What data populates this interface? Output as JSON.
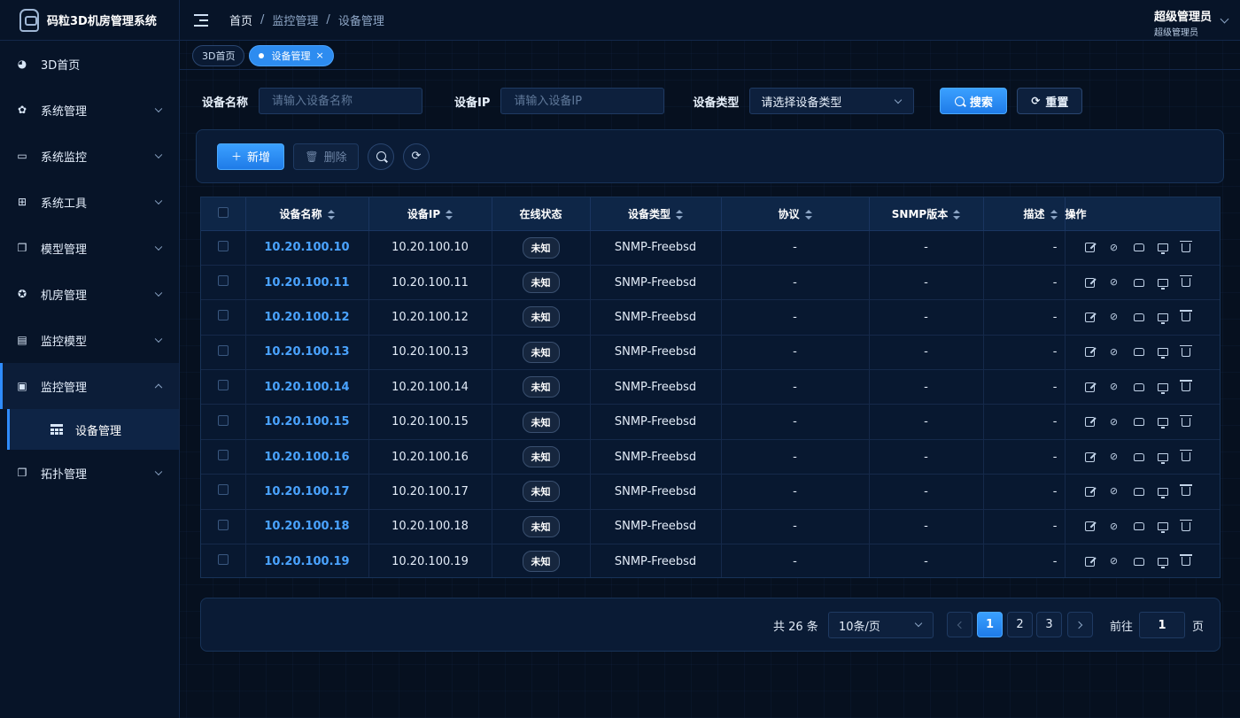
{
  "app": {
    "title": "码粒3D机房管理系统"
  },
  "sidebar": {
    "items": [
      {
        "label": "3D首页",
        "icon": "dashboard-icon",
        "has_children": false
      },
      {
        "label": "系统管理",
        "icon": "gear-icon",
        "has_children": true
      },
      {
        "label": "系统监控",
        "icon": "monitor-icon",
        "has_children": true
      },
      {
        "label": "系统工具",
        "icon": "toolbox-icon",
        "has_children": true
      },
      {
        "label": "模型管理",
        "icon": "copy-icon",
        "has_children": true
      },
      {
        "label": "机房管理",
        "icon": "lifebuoy-icon",
        "has_children": true
      },
      {
        "label": "监控模型",
        "icon": "server-icon",
        "has_children": true
      },
      {
        "label": "监控管理",
        "icon": "image-icon",
        "has_children": true,
        "open": true,
        "children": [
          {
            "label": "设备管理",
            "icon": "table-icon"
          }
        ]
      },
      {
        "label": "拓扑管理",
        "icon": "copy-icon",
        "has_children": true
      }
    ]
  },
  "header": {
    "breadcrumb": [
      "首页",
      "监控管理",
      "设备管理"
    ],
    "breadcrumb_sep": "/",
    "user_name": "超级管理员",
    "user_role": "超级管理员"
  },
  "tags": [
    {
      "label": "3D首页",
      "active": false
    },
    {
      "label": "设备管理",
      "active": true,
      "close": "×"
    }
  ],
  "search": {
    "name_label": "设备名称",
    "name_placeholder": "请输入设备名称",
    "ip_label": "设备IP",
    "ip_placeholder": "请输入设备IP",
    "type_label": "设备类型",
    "type_value": "请选择设备类型",
    "search_button": "搜索",
    "reset_button": "重置"
  },
  "toolbar": {
    "add_button": "新增",
    "delete_button": "删除"
  },
  "table": {
    "columns": [
      "设备名称",
      "设备IP",
      "在线状态",
      "设备类型",
      "协议",
      "SNMP版本",
      "描述",
      "操作"
    ],
    "rows": [
      {
        "name": "10.20.100.10",
        "ip": "10.20.100.10",
        "status": "未知",
        "type": "SNMP-Freebsd",
        "protocol": "-",
        "snmp": "-",
        "desc": "-"
      },
      {
        "name": "10.20.100.11",
        "ip": "10.20.100.11",
        "status": "未知",
        "type": "SNMP-Freebsd",
        "protocol": "-",
        "snmp": "-",
        "desc": "-"
      },
      {
        "name": "10.20.100.12",
        "ip": "10.20.100.12",
        "status": "未知",
        "type": "SNMP-Freebsd",
        "protocol": "-",
        "snmp": "-",
        "desc": "-"
      },
      {
        "name": "10.20.100.13",
        "ip": "10.20.100.13",
        "status": "未知",
        "type": "SNMP-Freebsd",
        "protocol": "-",
        "snmp": "-",
        "desc": "-"
      },
      {
        "name": "10.20.100.14",
        "ip": "10.20.100.14",
        "status": "未知",
        "type": "SNMP-Freebsd",
        "protocol": "-",
        "snmp": "-",
        "desc": "-"
      },
      {
        "name": "10.20.100.15",
        "ip": "10.20.100.15",
        "status": "未知",
        "type": "SNMP-Freebsd",
        "protocol": "-",
        "snmp": "-",
        "desc": "-"
      },
      {
        "name": "10.20.100.16",
        "ip": "10.20.100.16",
        "status": "未知",
        "type": "SNMP-Freebsd",
        "protocol": "-",
        "snmp": "-",
        "desc": "-"
      },
      {
        "name": "10.20.100.17",
        "ip": "10.20.100.17",
        "status": "未知",
        "type": "SNMP-Freebsd",
        "protocol": "-",
        "snmp": "-",
        "desc": "-"
      },
      {
        "name": "10.20.100.18",
        "ip": "10.20.100.18",
        "status": "未知",
        "type": "SNMP-Freebsd",
        "protocol": "-",
        "snmp": "-",
        "desc": "-"
      },
      {
        "name": "10.20.100.19",
        "ip": "10.20.100.19",
        "status": "未知",
        "type": "SNMP-Freebsd",
        "protocol": "-",
        "snmp": "-",
        "desc": "-"
      }
    ],
    "row_actions": [
      "edit-icon",
      "link-icon",
      "box-icon",
      "monitor-icon",
      "trash-icon"
    ]
  },
  "pagination": {
    "total_text": "共 26 条",
    "page_size": "10条/页",
    "pages": [
      "1",
      "2",
      "3"
    ],
    "current_page": "1",
    "goto_label": "前往",
    "goto_value": "1",
    "goto_unit": "页"
  },
  "colors": {
    "accent": "#2d8cf0",
    "background": "#06101f",
    "link": "#4aa3ff"
  }
}
